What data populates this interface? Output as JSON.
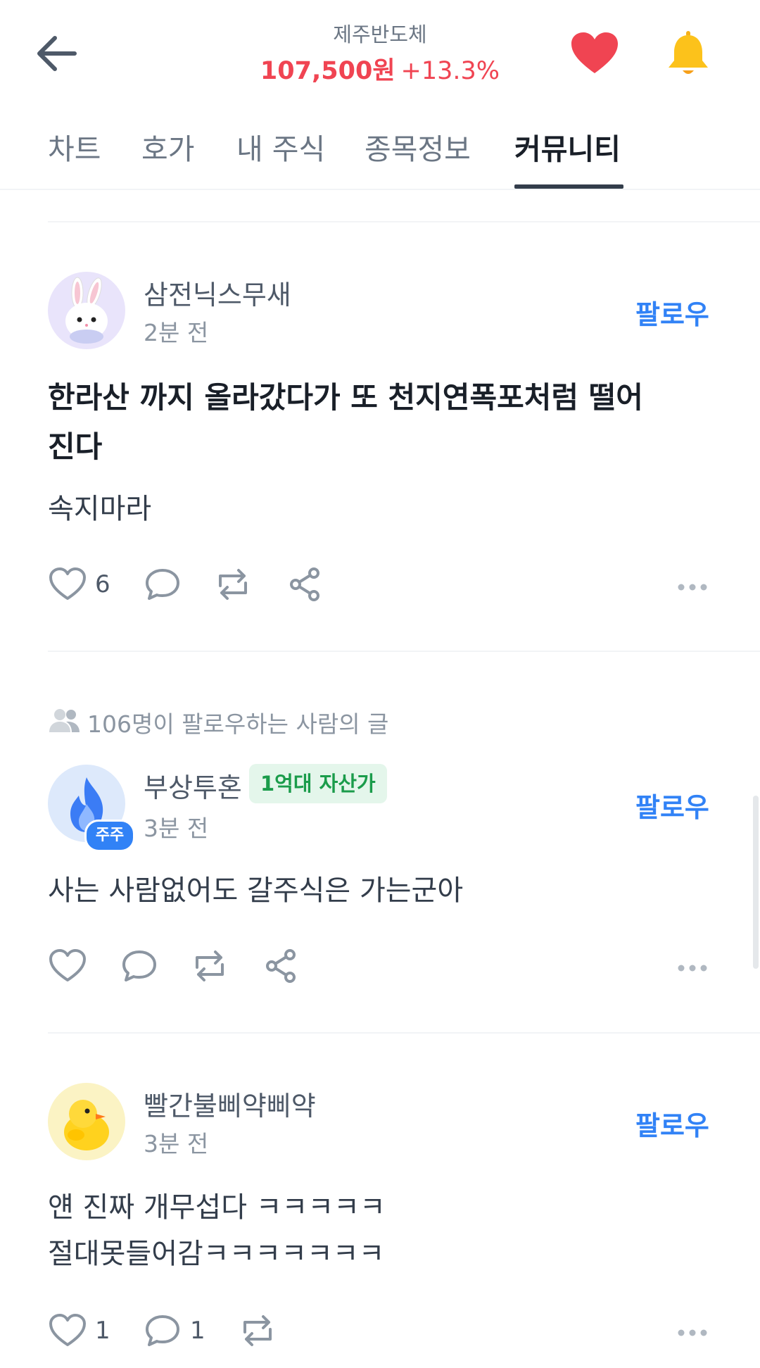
{
  "header": {
    "back_icon": "arrow-left-icon",
    "stock_name": "제주반도체",
    "price": "107,500원",
    "change": "+13.3%",
    "price_color": "#f04452",
    "heart_icon": "heart-icon",
    "bell_icon": "bell-icon"
  },
  "tabs": [
    {
      "label": "차트"
    },
    {
      "label": "호가"
    },
    {
      "label": "내 주식"
    },
    {
      "label": "종목정보"
    },
    {
      "label": "커뮤니티",
      "active": true
    }
  ],
  "posts": [
    {
      "username": "삼전닉스무새",
      "time": "2분 전",
      "follow_label": "팔로우",
      "title": "한라산 까지 올라갔다가 또 천지연폭포처럼 떨어진다",
      "body": "속지마라",
      "likes": "6",
      "comments": "",
      "avatar": "rabbit-avatar"
    },
    {
      "note": "106명이 팔로우하는 사람의 글",
      "username": "부상투혼",
      "badge": "1억대 자산가",
      "holder_badge": "주주",
      "time": "3분 전",
      "follow_label": "팔로우",
      "body": "사는 사람없어도 갈주식은 가는군아",
      "avatar": "flame-avatar"
    },
    {
      "username": "빨간불삐약삐약",
      "time": "3분 전",
      "follow_label": "팔로우",
      "body": "얜 진짜 개무섭다 ㅋㅋㅋㅋㅋ\n절대못들어감ㅋㅋㅋㅋㅋㅋㅋ",
      "likes": "1",
      "comments": "1",
      "avatar": "chick-avatar"
    }
  ]
}
